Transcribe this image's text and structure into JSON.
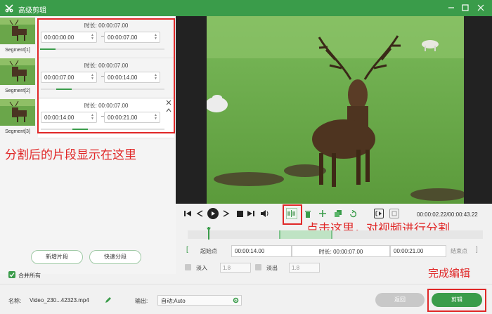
{
  "window": {
    "title": "高级剪辑"
  },
  "segments": [
    {
      "name": "Segment[1]",
      "duration": "时长: 00:00:07.00",
      "start": "00:00:00.00",
      "end": "00:00:07.00",
      "progress": 0.12
    },
    {
      "name": "Segment[2]",
      "duration": "时长: 00:00:07.00",
      "start": "00:00:07.00",
      "end": "00:00:14.00",
      "progress": 0.25
    },
    {
      "name": "Segment[3]",
      "duration": "时长: 00:00:07.00",
      "start": "00:00:14.00",
      "end": "00:00:21.00",
      "progress": 0.38
    }
  ],
  "left_actions": {
    "add_segment": "新增片段",
    "quick_split": "快速分段",
    "merge_all": "合并所有",
    "merge_checked": true
  },
  "annotations": {
    "segments_note": "分割后的片段显示在这里",
    "split_note": "点击这里，对视频进行分割",
    "finish_note": "完成编辑"
  },
  "player": {
    "current_time": "00:00:02.22",
    "total_time": "00:00:43.22",
    "time_display": "00:00:02.22/00:00:43.22",
    "playhead_fraction": 0.07,
    "selection_start_fraction": 0.31,
    "selection_end_fraction": 0.49
  },
  "inout": {
    "start_label": "起始点",
    "start_value": "00:00:14.00",
    "duration_label": "时长",
    "duration_value": "00:00:07.00",
    "end_value": "00:00:21.00",
    "end_label": "结束点"
  },
  "fade": {
    "fade_in_label": "淡入",
    "fade_in_value": "1.8",
    "fade_out_label": "淡出",
    "fade_out_value": "1.8"
  },
  "bottom": {
    "name_label": "名称:",
    "file_name": "Video_230...42323.mp4",
    "output_label": "输出:",
    "output_value": "自动;Auto",
    "return_label": "返回",
    "edit_label": "剪辑"
  },
  "colors": {
    "brand_green": "#3a9c4a",
    "annotation_red": "#e02828"
  }
}
